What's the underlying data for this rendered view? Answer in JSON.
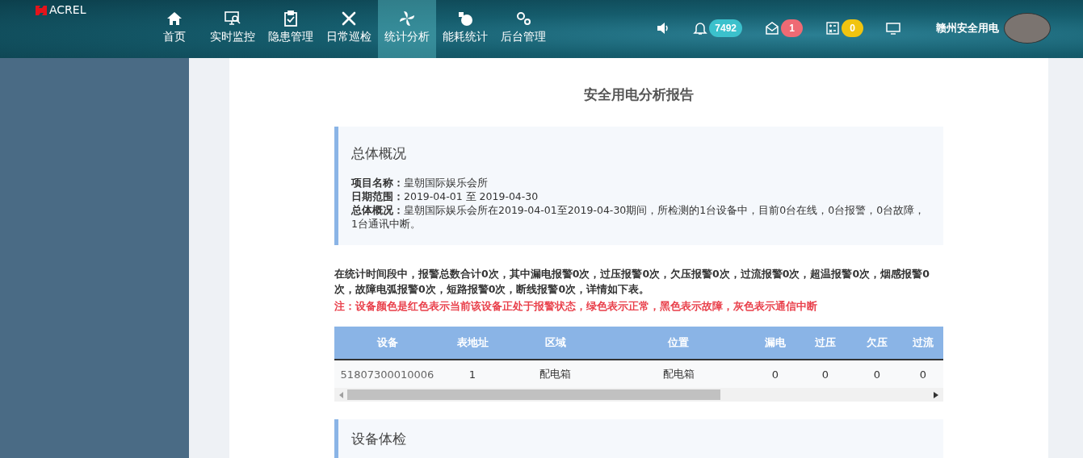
{
  "header": {
    "logo": "ACREL",
    "nav": [
      {
        "label": "首页",
        "selected": false
      },
      {
        "label": "实时监控",
        "selected": false
      },
      {
        "label": "隐患管理",
        "selected": false
      },
      {
        "label": "日常巡检",
        "selected": false
      },
      {
        "label": "统计分析",
        "selected": true
      },
      {
        "label": "能耗统计",
        "selected": false
      },
      {
        "label": "后台管理",
        "selected": false
      }
    ],
    "indicators": [
      {
        "kind": "speaker"
      },
      {
        "kind": "bell",
        "count": "7492",
        "color": "#3bc1cc"
      },
      {
        "kind": "mail",
        "count": "1",
        "color": "#ef6a74"
      },
      {
        "kind": "calculator",
        "count": "0",
        "color": "#f1c40f"
      },
      {
        "kind": "screen"
      }
    ],
    "user": "赣州安全用电"
  },
  "report": {
    "title": "安全用电分析报告",
    "overview": {
      "heading": "总体概况",
      "fields": [
        {
          "label": "项目名称：",
          "value": "皇朝国际娱乐会所"
        },
        {
          "label": "日期范围：",
          "value": "2019-04-01 至 2019-04-30"
        },
        {
          "label": "总体概况：",
          "value": "皇朝国际娱乐会所在2019-04-01至2019-04-30期间，所检测的1台设备中，目前0台在线，0台报警，0台故障，1台通讯中断。"
        }
      ]
    },
    "summary": "在统计时间段中，报警总数合计0次，其中漏电报警0次，过压报警0次，欠压报警0次，过流报警0次，超温报警0次，烟感报警0次，故障电弧报警0次，短路报警0次，断线报警0次，详情如下表。",
    "note": "注：设备颜色是红色表示当前该设备正处于报警状态，绿色表示正常，黑色表示故障，灰色表示通信中断",
    "table": {
      "columns": [
        "设备",
        "表地址",
        "区域",
        "位置",
        "漏电",
        "过压",
        "欠压",
        "过流"
      ],
      "rows": [
        {
          "cells": [
            "51807300010006",
            "1",
            "配电箱",
            "配电箱",
            "0",
            "0",
            "0",
            "0"
          ],
          "color": "#666666"
        }
      ]
    },
    "next_section": {
      "heading": "设备体检"
    }
  }
}
